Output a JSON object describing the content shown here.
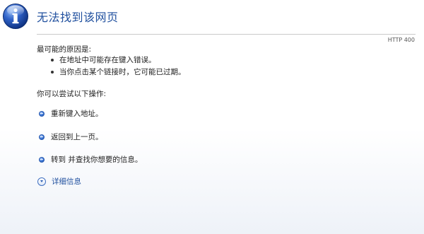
{
  "page": {
    "title": "无法找到该网页",
    "status_code": "HTTP 400"
  },
  "reasons": {
    "heading": "最可能的原因是:",
    "items": [
      "在地址中可能存在键入错误。",
      "当你点击某个链接时，它可能已过期。"
    ]
  },
  "actions": {
    "heading": "你可以尝试以下操作:",
    "items": [
      "重新键入地址。",
      "返回到上一页。",
      "转到  并查找你想要的信息。"
    ]
  },
  "details": {
    "label": "详细信息"
  },
  "colors": {
    "title": "#1f4f9e",
    "link": "#1f4f9e",
    "bullet": "#3e78d6"
  },
  "icons": {
    "page_icon": "info-icon",
    "action_bullet": "blue-dot-icon",
    "details_toggle": "chevron-down-circle-icon"
  }
}
